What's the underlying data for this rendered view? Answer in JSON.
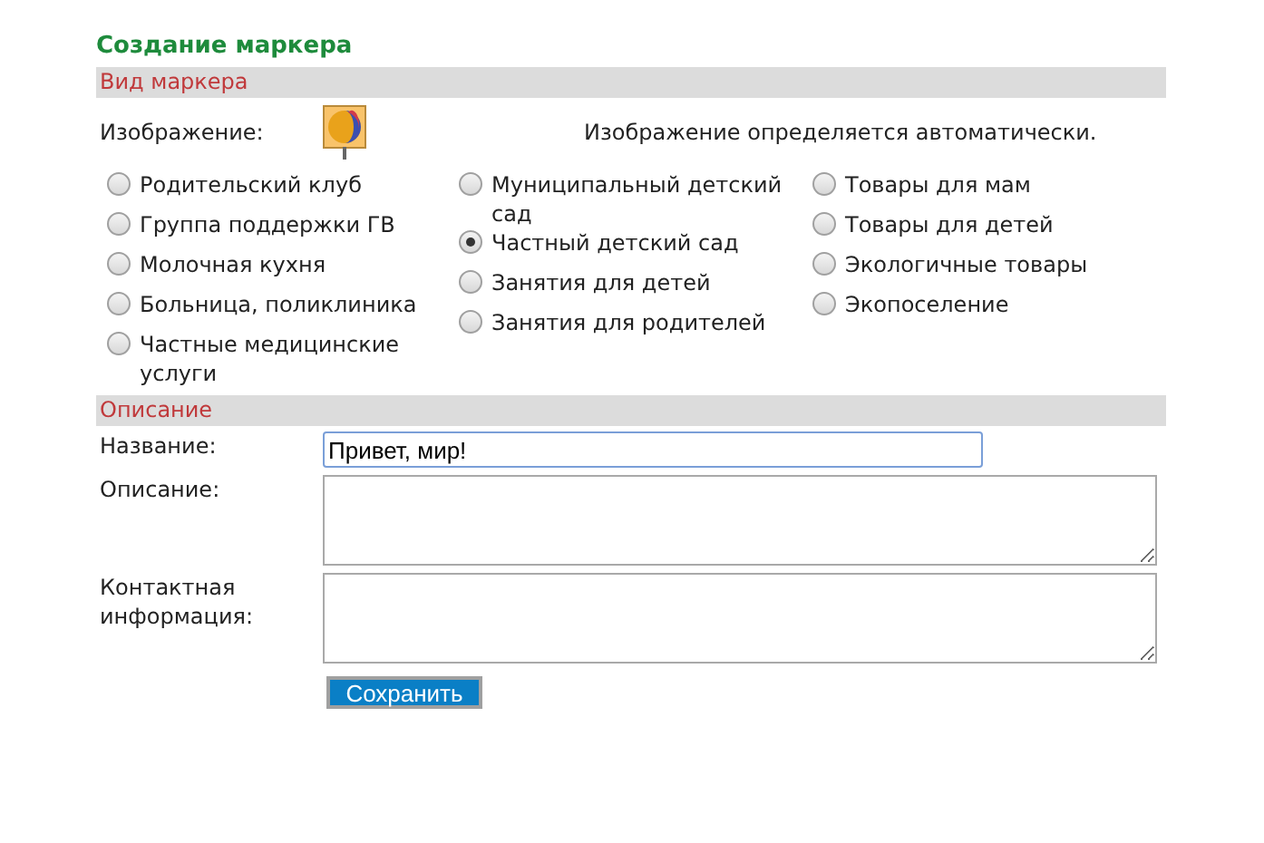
{
  "title": "Создание маркера",
  "marker_section": {
    "heading": "Вид маркера",
    "image_label": "Изображение:",
    "image_note": "Изображение определяется автоматически.",
    "columns": [
      [
        {
          "label": "Родительский клуб",
          "selected": false
        },
        {
          "label": "Группа поддержки ГВ",
          "selected": false
        },
        {
          "label": "Молочная кухня",
          "selected": false
        },
        {
          "label": "Больница, поликлиника",
          "selected": false
        },
        {
          "label": "Частные медицинские услуги",
          "selected": false
        }
      ],
      [
        {
          "label": "Муниципальный детский сад",
          "selected": false
        },
        {
          "label": "Частный детский сад",
          "selected": true
        },
        {
          "label": "Занятия для детей",
          "selected": false
        },
        {
          "label": "Занятия для родителей",
          "selected": false
        }
      ],
      [
        {
          "label": "Товары для мам",
          "selected": false
        },
        {
          "label": "Товары для детей",
          "selected": false
        },
        {
          "label": "Экологичные товары",
          "selected": false
        },
        {
          "label": "Экопоселение",
          "selected": false
        }
      ]
    ]
  },
  "description_section": {
    "heading": "Описание",
    "fields": [
      {
        "kind": "input",
        "label": "Название:",
        "value": "Привет, мир!"
      },
      {
        "kind": "textarea",
        "label": "Описание:"
      },
      {
        "kind": "textarea",
        "label": "Контактная информация:"
      }
    ]
  },
  "save_button": "Сохранить"
}
